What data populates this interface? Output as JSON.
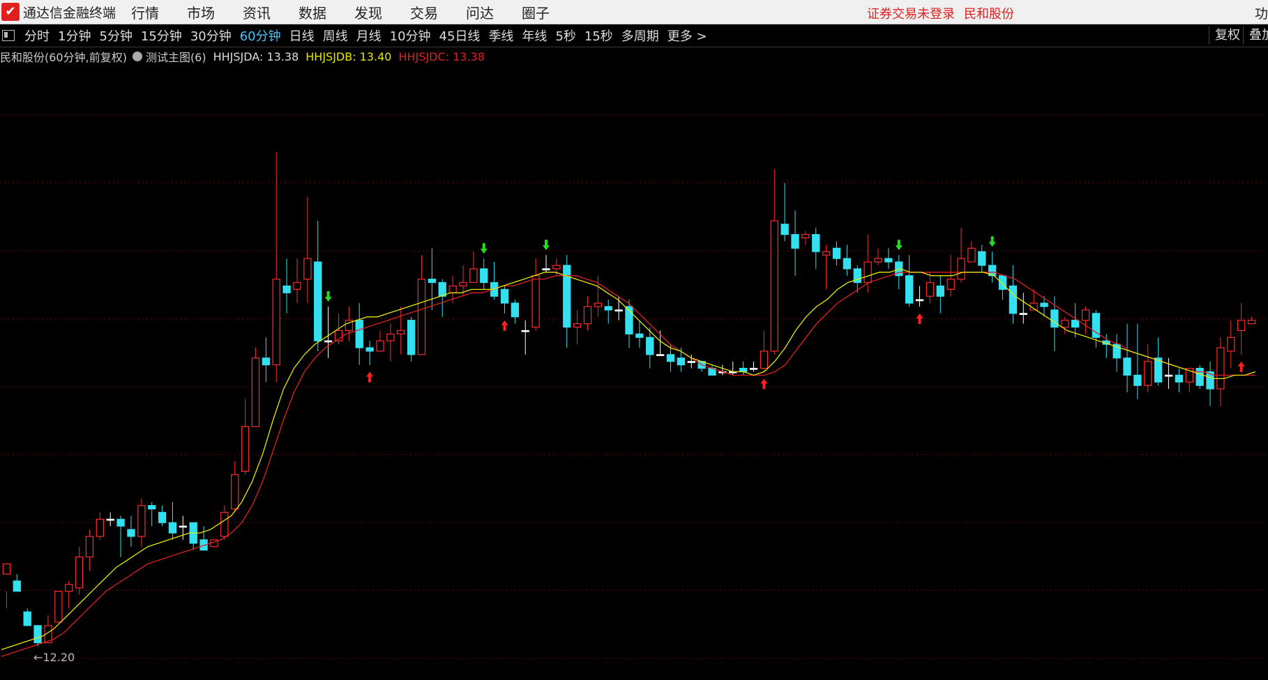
{
  "app": {
    "logo_glyph": "✔",
    "title": "通达信金融终端",
    "login_status": "证券交易未登录",
    "stock": "民和股份",
    "edge_text": "功"
  },
  "menu": [
    "行情",
    "市场",
    "资讯",
    "数据",
    "发现",
    "交易",
    "问达",
    "圈子"
  ],
  "periods": [
    "分时",
    "1分钟",
    "5分钟",
    "15分钟",
    "30分钟",
    "60分钟",
    "日线",
    "周线",
    "月线",
    "10分钟",
    "45日线",
    "季线",
    "年线",
    "5秒",
    "15秒",
    "多周期",
    "更多 >"
  ],
  "active_period": "60分钟",
  "right_buttons": {
    "fuquan": "复权",
    "diejia": "叠加"
  },
  "info": {
    "stock_label": "民和股份(60分钟,前复权)",
    "main_chart": "测试主图(6)",
    "ind_a": "HHJSJDA: 13.38",
    "ind_b": "HHJSJDB: 13.40",
    "ind_c": "HHJSJDC: 13.38"
  },
  "colors": {
    "up": "#ff2a2a",
    "down": "#33e0f0",
    "doji": "#ffffff",
    "line_b": "#e8e800",
    "line_c": "#e02020",
    "grid": "#6a0000",
    "buy_arrow": "#ff2020",
    "sell_arrow": "#22dd22",
    "active_period": "#49c6f7"
  },
  "chart_data": {
    "type": "candlestick",
    "price_range": [
      12.14,
      13.85
    ],
    "low_marker": "←12.20",
    "candles": [
      [
        12.41,
        12.44,
        12.36,
        12.31
      ],
      [
        12.39,
        12.36,
        12.41,
        12.36
      ],
      [
        12.3,
        12.26,
        12.31,
        12.26
      ],
      [
        12.26,
        12.21,
        12.25,
        12.2
      ],
      [
        12.21,
        12.26,
        12.29,
        12.21
      ],
      [
        12.27,
        12.36,
        12.36,
        12.27
      ],
      [
        12.36,
        12.38,
        12.39,
        12.31
      ],
      [
        12.37,
        12.46,
        12.49,
        12.35
      ],
      [
        12.46,
        12.52,
        12.54,
        12.42
      ],
      [
        12.52,
        12.57,
        12.59,
        12.51
      ],
      [
        12.57,
        12.57,
        12.59,
        12.55
      ],
      [
        12.57,
        12.55,
        12.58,
        12.46
      ],
      [
        12.54,
        12.52,
        12.58,
        12.49
      ],
      [
        12.52,
        12.61,
        12.63,
        12.49
      ],
      [
        12.61,
        12.6,
        12.62,
        12.55
      ],
      [
        12.59,
        12.56,
        12.61,
        12.55
      ],
      [
        12.56,
        12.53,
        12.62,
        12.51
      ],
      [
        12.55,
        12.55,
        12.58,
        12.51
      ],
      [
        12.56,
        12.5,
        12.56,
        12.48
      ],
      [
        12.51,
        12.48,
        12.55,
        12.49
      ],
      [
        12.49,
        12.51,
        12.51,
        12.49
      ],
      [
        12.52,
        12.59,
        12.61,
        12.51
      ],
      [
        12.6,
        12.7,
        12.74,
        12.59
      ],
      [
        12.71,
        12.84,
        12.92,
        12.7
      ],
      [
        12.84,
        13.04,
        13.07,
        12.84
      ],
      [
        13.04,
        13.02,
        13.1,
        12.97
      ],
      [
        13.02,
        13.27,
        13.64,
        12.97
      ],
      [
        13.25,
        13.23,
        13.33,
        13.17
      ],
      [
        13.24,
        13.26,
        13.33,
        13.2
      ],
      [
        13.27,
        13.33,
        13.51,
        13.2
      ],
      [
        13.32,
        13.09,
        13.44,
        13.06
      ],
      [
        13.09,
        13.09,
        13.19,
        13.04
      ],
      [
        13.09,
        13.12,
        13.17,
        13.08
      ],
      [
        13.12,
        13.15,
        13.19,
        13.09
      ],
      [
        13.15,
        13.07,
        13.2,
        13.02
      ],
      [
        13.07,
        13.06,
        13.09,
        13.02
      ],
      [
        13.06,
        13.09,
        13.12,
        13.06
      ],
      [
        13.09,
        13.11,
        13.14,
        13.03
      ],
      [
        13.11,
        13.12,
        13.19,
        13.05
      ],
      [
        13.15,
        13.05,
        13.16,
        13.03
      ],
      [
        13.05,
        13.27,
        13.34,
        13.05
      ],
      [
        13.27,
        13.26,
        13.36,
        13.18
      ],
      [
        13.26,
        13.22,
        13.27,
        13.16
      ],
      [
        13.23,
        13.25,
        13.28,
        13.2
      ],
      [
        13.25,
        13.26,
        13.31,
        13.22
      ],
      [
        13.26,
        13.3,
        13.35,
        13.26
      ],
      [
        13.3,
        13.26,
        13.33,
        13.24
      ],
      [
        13.26,
        13.22,
        13.32,
        13.21
      ],
      [
        13.24,
        13.2,
        13.25,
        13.17
      ],
      [
        13.2,
        13.16,
        13.21,
        13.14
      ],
      [
        13.12,
        13.12,
        13.15,
        13.05
      ],
      [
        13.13,
        13.28,
        13.33,
        13.12
      ],
      [
        13.3,
        13.3,
        13.34,
        13.29
      ],
      [
        13.3,
        13.31,
        13.33,
        13.28
      ],
      [
        13.31,
        13.13,
        13.34,
        13.07
      ],
      [
        13.13,
        13.14,
        13.18,
        13.08
      ],
      [
        13.14,
        13.19,
        13.22,
        13.12
      ],
      [
        13.19,
        13.2,
        13.28,
        13.16
      ],
      [
        13.19,
        13.18,
        13.21,
        13.14
      ],
      [
        13.18,
        13.18,
        13.22,
        13.15
      ],
      [
        13.19,
        13.11,
        13.21,
        13.07
      ],
      [
        13.11,
        13.1,
        13.15,
        13.07
      ],
      [
        13.1,
        13.05,
        13.13,
        13.01
      ],
      [
        13.05,
        13.05,
        13.12,
        13.05
      ],
      [
        13.05,
        13.03,
        13.08,
        13.0
      ],
      [
        13.04,
        13.02,
        13.07,
        13.0
      ],
      [
        13.03,
        13.03,
        13.05,
        13.01
      ],
      [
        13.03,
        13.01,
        13.03,
        13.0
      ],
      [
        13.01,
        12.99,
        13.02,
        12.99
      ],
      [
        13.0,
        13.0,
        13.02,
        12.99
      ],
      [
        13.0,
        13.0,
        13.03,
        12.99
      ],
      [
        13.01,
        13.0,
        13.03,
        12.99
      ],
      [
        13.01,
        13.01,
        13.03,
        13.0
      ],
      [
        13.01,
        13.06,
        13.12,
        13.0
      ],
      [
        13.06,
        13.44,
        13.59,
        13.05
      ],
      [
        13.43,
        13.4,
        13.55,
        13.38
      ],
      [
        13.4,
        13.36,
        13.47,
        13.28
      ],
      [
        13.39,
        13.4,
        13.41,
        13.37
      ],
      [
        13.4,
        13.35,
        13.42,
        13.3
      ],
      [
        13.34,
        13.35,
        13.37,
        13.24
      ],
      [
        13.36,
        13.33,
        13.38,
        13.31
      ],
      [
        13.33,
        13.3,
        13.37,
        13.28
      ],
      [
        13.3,
        13.26,
        13.31,
        13.23
      ],
      [
        13.26,
        13.32,
        13.4,
        13.23
      ],
      [
        13.32,
        13.33,
        13.36,
        13.31
      ],
      [
        13.33,
        13.32,
        13.36,
        13.3
      ],
      [
        13.32,
        13.28,
        13.34,
        13.24
      ],
      [
        13.28,
        13.2,
        13.34,
        13.19
      ],
      [
        13.21,
        13.21,
        13.25,
        13.19
      ],
      [
        13.22,
        13.26,
        13.29,
        13.2
      ],
      [
        13.25,
        13.22,
        13.28,
        13.17
      ],
      [
        13.24,
        13.27,
        13.34,
        13.22
      ],
      [
        13.27,
        13.33,
        13.42,
        13.26
      ],
      [
        13.32,
        13.36,
        13.38,
        13.32
      ],
      [
        13.35,
        13.31,
        13.37,
        13.29
      ],
      [
        13.31,
        13.28,
        13.35,
        13.26
      ],
      [
        13.28,
        13.24,
        13.27,
        13.21
      ],
      [
        13.25,
        13.17,
        13.31,
        13.14
      ],
      [
        13.17,
        13.17,
        13.23,
        13.14
      ],
      [
        13.18,
        13.2,
        13.24,
        13.18
      ],
      [
        13.2,
        13.19,
        13.22,
        13.16
      ],
      [
        13.18,
        13.13,
        13.22,
        13.06
      ],
      [
        13.13,
        13.15,
        13.16,
        13.11
      ],
      [
        13.15,
        13.13,
        13.2,
        13.1
      ],
      [
        13.15,
        13.18,
        13.19,
        13.11
      ],
      [
        13.17,
        13.1,
        13.18,
        13.07
      ],
      [
        13.09,
        13.08,
        13.11,
        13.04
      ],
      [
        13.08,
        13.04,
        13.11,
        13.0
      ],
      [
        13.04,
        12.99,
        13.14,
        12.94
      ],
      [
        12.99,
        12.96,
        13.14,
        12.92
      ],
      [
        12.96,
        13.03,
        13.08,
        12.94
      ],
      [
        13.04,
        12.97,
        13.1,
        12.96
      ],
      [
        12.99,
        12.99,
        13.04,
        12.95
      ],
      [
        12.99,
        12.97,
        13.01,
        12.94
      ],
      [
        12.97,
        13.01,
        13.01,
        12.94
      ],
      [
        13.01,
        12.96,
        13.02,
        12.95
      ],
      [
        13.0,
        12.95,
        13.03,
        12.9
      ],
      [
        12.95,
        13.07,
        13.1,
        12.9
      ],
      [
        13.06,
        13.1,
        13.15,
        13.01
      ],
      [
        13.12,
        13.15,
        13.2,
        13.05
      ],
      [
        13.14,
        13.15,
        13.16,
        13.14
      ]
    ],
    "line_b": [
      12.19,
      12.2,
      12.21,
      12.22,
      12.23,
      12.25,
      12.28,
      12.31,
      12.34,
      12.37,
      12.4,
      12.43,
      12.45,
      12.47,
      12.49,
      12.5,
      12.51,
      12.52,
      12.53,
      12.53,
      12.54,
      12.56,
      12.58,
      12.62,
      12.68,
      12.76,
      12.86,
      12.95,
      13.01,
      13.05,
      13.08,
      13.1,
      13.12,
      13.14,
      13.15,
      13.16,
      13.16,
      13.17,
      13.18,
      13.19,
      13.2,
      13.21,
      13.22,
      13.23,
      13.23,
      13.24,
      13.24,
      13.24,
      13.25,
      13.26,
      13.27,
      13.28,
      13.29,
      13.29,
      13.28,
      13.27,
      13.26,
      13.25,
      13.23,
      13.21,
      13.18,
      13.15,
      13.12,
      13.09,
      13.07,
      13.06,
      13.04,
      13.03,
      13.02,
      13.01,
      13.0,
      13.0,
      12.99,
      13.0,
      13.03,
      13.07,
      13.12,
      13.16,
      13.19,
      13.21,
      13.24,
      13.26,
      13.27,
      13.28,
      13.29,
      13.29,
      13.3,
      13.29,
      13.29,
      13.28,
      13.28,
      13.28,
      13.29,
      13.29,
      13.29,
      13.28,
      13.25,
      13.22,
      13.2,
      13.18,
      13.16,
      13.14,
      13.12,
      13.11,
      13.1,
      13.09,
      13.08,
      13.07,
      13.06,
      13.05,
      13.04,
      13.03,
      13.02,
      13.01,
      13.0,
      12.99,
      12.98,
      12.98,
      12.99,
      12.99,
      13.0
    ],
    "line_c": [
      12.17,
      12.18,
      12.19,
      12.2,
      12.21,
      12.22,
      12.24,
      12.27,
      12.3,
      12.33,
      12.36,
      12.38,
      12.4,
      12.42,
      12.44,
      12.45,
      12.46,
      12.47,
      12.48,
      12.49,
      12.5,
      12.51,
      12.53,
      12.56,
      12.61,
      12.68,
      12.77,
      12.86,
      12.94,
      13.0,
      13.04,
      13.07,
      13.09,
      13.11,
      13.12,
      13.13,
      13.14,
      13.15,
      13.16,
      13.17,
      13.18,
      13.19,
      13.2,
      13.21,
      13.22,
      13.23,
      13.23,
      13.24,
      13.25,
      13.25,
      13.26,
      13.27,
      13.27,
      13.28,
      13.28,
      13.28,
      13.27,
      13.26,
      13.24,
      13.22,
      13.2,
      13.17,
      13.14,
      13.11,
      13.08,
      13.06,
      13.04,
      13.02,
      13.01,
      13.0,
      12.99,
      12.99,
      12.99,
      12.99,
      13.0,
      13.02,
      13.06,
      13.1,
      13.14,
      13.17,
      13.2,
      13.22,
      13.24,
      13.26,
      13.27,
      13.28,
      13.29,
      13.29,
      13.29,
      13.29,
      13.29,
      13.29,
      13.29,
      13.29,
      13.29,
      13.29,
      13.28,
      13.27,
      13.25,
      13.23,
      13.21,
      13.19,
      13.17,
      13.15,
      13.13,
      13.11,
      13.09,
      13.08,
      13.06,
      13.05,
      13.04,
      13.03,
      13.02,
      13.01,
      13.0,
      13.0,
      12.99,
      12.99,
      12.99,
      12.99,
      12.99
    ],
    "buy_signals": [
      35,
      48,
      73,
      88,
      119
    ],
    "sell_signals": [
      31,
      46,
      52,
      86,
      95
    ]
  }
}
